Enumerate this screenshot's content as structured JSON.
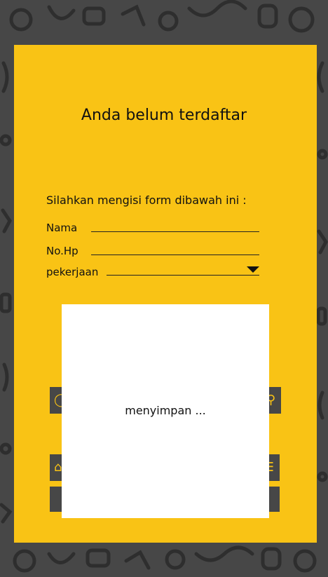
{
  "form": {
    "title": "Anda belum terdaftar",
    "instruction": "Silahkan mengisi form dibawah ini :",
    "fields": [
      {
        "label": "Nama",
        "value": ""
      },
      {
        "label": "No.Hp",
        "value": ""
      },
      {
        "label": "pekerjaan",
        "value": ""
      }
    ]
  },
  "dialog": {
    "message": "menyimpan ..."
  },
  "colors": {
    "card": "#f9c315",
    "background": "#474747",
    "dialog": "#ffffff"
  }
}
